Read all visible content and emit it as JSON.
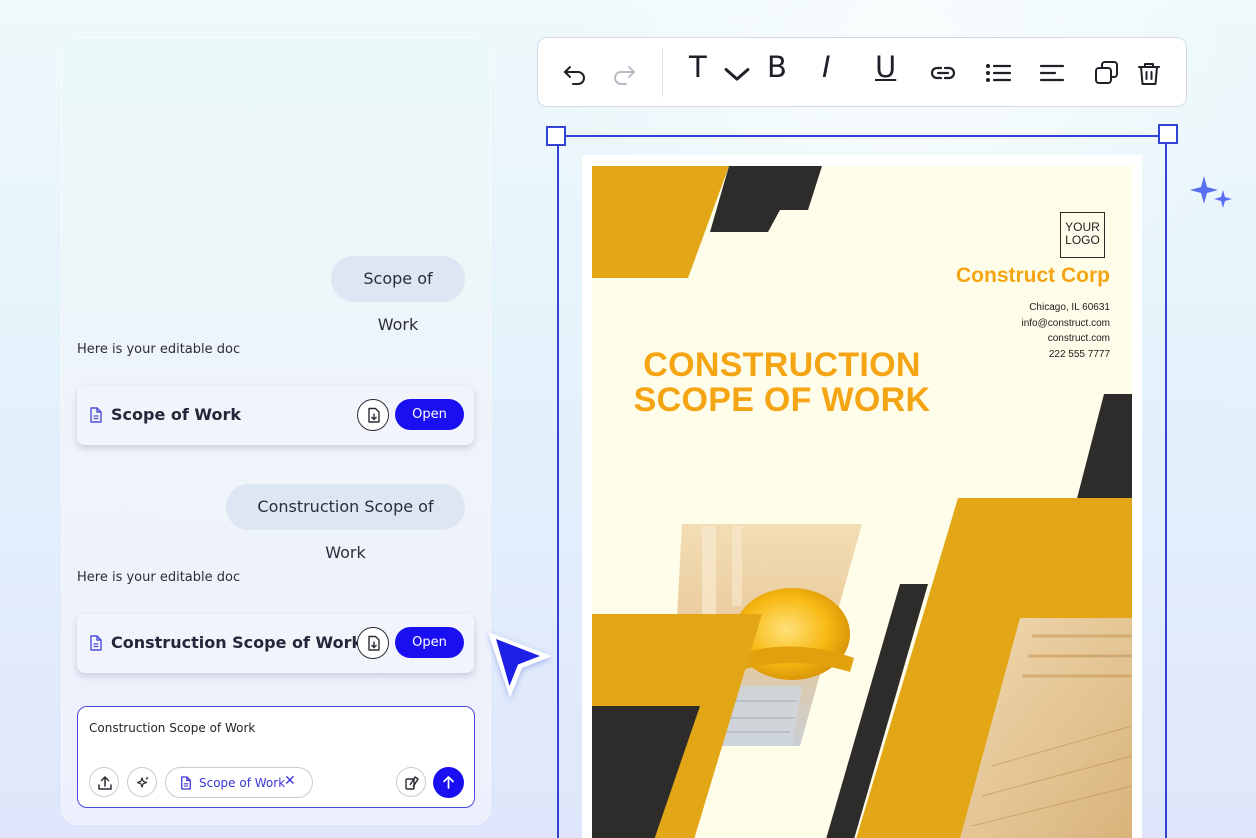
{
  "chat": {
    "messages": [
      {
        "role": "user",
        "text": "Scope of Work"
      },
      {
        "role": "assistant",
        "text": "Here is your editable doc",
        "doc_title": "Scope of Work",
        "open_label": "Open"
      },
      {
        "role": "user",
        "text": "Construction Scope of Work"
      },
      {
        "role": "assistant",
        "text": "Here is your editable doc",
        "doc_title": "Construction Scope of Work",
        "open_label": "Open"
      }
    ],
    "input": {
      "value": "Construction Scope of Work",
      "attachment_chip": "Scope of Work",
      "chip_close": "✕"
    }
  },
  "toolbar": {
    "buttons": [
      "undo",
      "redo",
      "text-style",
      "bold",
      "italic",
      "underline",
      "link",
      "bulleted-list",
      "align",
      "duplicate",
      "delete"
    ],
    "text_style_label": "T",
    "bold_label": "B",
    "italic_label": "I",
    "underline_label": "U"
  },
  "document": {
    "logo_text": "YOUR LOGO",
    "company": "Construct Corp",
    "contact": [
      "Chicago, IL 60631",
      "info@construct.com",
      "construct.com",
      "222 555 7777"
    ],
    "heading": "CONSTRUCTION SCOPE OF WORK"
  },
  "colors": {
    "accent": "#1a0ff0",
    "selection": "#3343d6",
    "doc_yellow": "#e2a617",
    "doc_dark": "#2d2c2a",
    "doc_orange_text": "#f5a413"
  }
}
